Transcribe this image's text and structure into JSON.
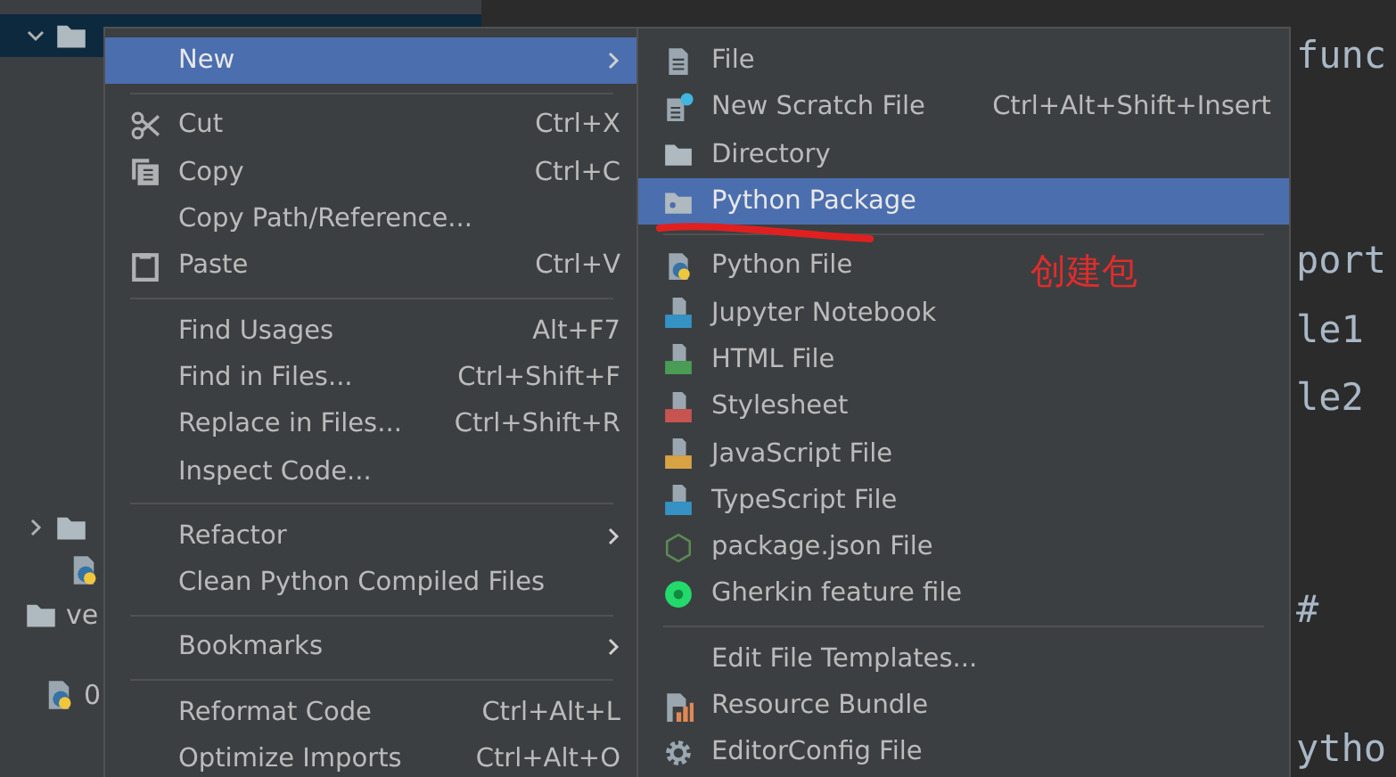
{
  "project_tree": {
    "rows": [
      {
        "expanded": true,
        "selected": true
      },
      {
        "expanded": false,
        "selected": false
      },
      {
        "selected": false
      },
      {
        "label": "ve",
        "selected": false
      },
      {
        "label": "0",
        "selected": false
      }
    ]
  },
  "editor": {
    "lines": [
      "func",
      "port",
      "le1",
      "le2",
      "#",
      "ytho"
    ]
  },
  "context_menu": {
    "items": [
      {
        "kind": "item",
        "label": "New",
        "submenu": true,
        "selected": true
      },
      {
        "kind": "separator"
      },
      {
        "kind": "item",
        "label": "Cut",
        "shortcut": "Ctrl+X",
        "selected": false
      },
      {
        "kind": "item",
        "label": "Copy",
        "shortcut": "Ctrl+C",
        "selected": false
      },
      {
        "kind": "item",
        "label": "Copy Path/Reference...",
        "selected": false
      },
      {
        "kind": "item",
        "label": "Paste",
        "shortcut": "Ctrl+V",
        "selected": false
      },
      {
        "kind": "separator"
      },
      {
        "kind": "item",
        "label": "Find Usages",
        "shortcut": "Alt+F7",
        "selected": false
      },
      {
        "kind": "item",
        "label": "Find in Files...",
        "shortcut": "Ctrl+Shift+F",
        "selected": false
      },
      {
        "kind": "item",
        "label": "Replace in Files...",
        "shortcut": "Ctrl+Shift+R",
        "selected": false
      },
      {
        "kind": "item",
        "label": "Inspect Code...",
        "selected": false
      },
      {
        "kind": "separator"
      },
      {
        "kind": "item",
        "label": "Refactor",
        "submenu": true,
        "selected": false
      },
      {
        "kind": "item",
        "label": "Clean Python Compiled Files",
        "selected": false
      },
      {
        "kind": "separator"
      },
      {
        "kind": "item",
        "label": "Bookmarks",
        "submenu": true,
        "selected": false
      },
      {
        "kind": "separator"
      },
      {
        "kind": "item",
        "label": "Reformat Code",
        "shortcut": "Ctrl+Alt+L",
        "selected": false
      },
      {
        "kind": "item",
        "label": "Optimize Imports",
        "shortcut": "Ctrl+Alt+O",
        "selected": false
      }
    ]
  },
  "new_submenu": {
    "items": [
      {
        "kind": "item",
        "label": "File",
        "selected": false
      },
      {
        "kind": "item",
        "label": "New Scratch File",
        "shortcut": "Ctrl+Alt+Shift+Insert",
        "selected": false
      },
      {
        "kind": "item",
        "label": "Directory",
        "selected": false
      },
      {
        "kind": "item",
        "label": "Python Package",
        "selected": true
      },
      {
        "kind": "separator"
      },
      {
        "kind": "item",
        "label": "Python File",
        "selected": false
      },
      {
        "kind": "item",
        "label": "Jupyter Notebook",
        "selected": false
      },
      {
        "kind": "item",
        "label": "HTML File",
        "selected": false
      },
      {
        "kind": "item",
        "label": "Stylesheet",
        "selected": false
      },
      {
        "kind": "item",
        "label": "JavaScript File",
        "selected": false
      },
      {
        "kind": "item",
        "label": "TypeScript File",
        "selected": false
      },
      {
        "kind": "item",
        "label": "package.json File",
        "selected": false
      },
      {
        "kind": "item",
        "label": "Gherkin feature file",
        "selected": false
      },
      {
        "kind": "separator"
      },
      {
        "kind": "item",
        "label": "Edit File Templates...",
        "selected": false
      },
      {
        "kind": "item",
        "label": "Resource Bundle",
        "selected": false
      },
      {
        "kind": "item",
        "label": "EditorConfig File",
        "selected": false
      }
    ]
  },
  "annotation": {
    "text": "创建包"
  }
}
